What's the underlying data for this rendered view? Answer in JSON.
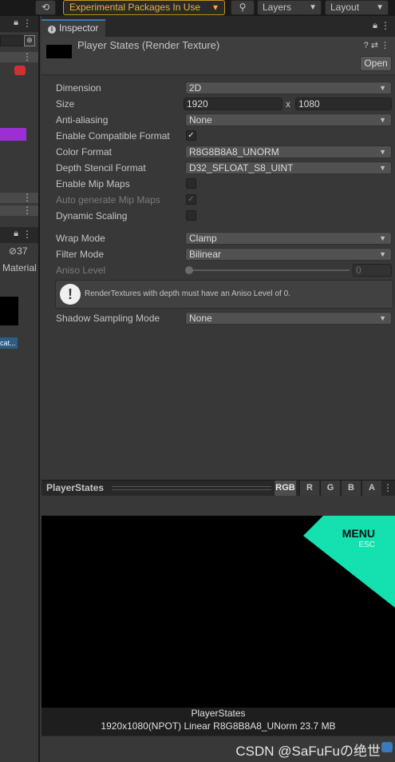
{
  "toolbar": {
    "experimental_label": "Experimental Packages In Use",
    "layers_label": "Layers",
    "layout_label": "Layout"
  },
  "left_panel": {
    "count_badge": "37",
    "material_label": "Material",
    "truncated_item": "cat..."
  },
  "inspector": {
    "tab_label": "Inspector",
    "asset_title": "Player States (Render Texture)",
    "open_label": "Open",
    "properties": {
      "dimension": {
        "label": "Dimension",
        "value": "2D"
      },
      "size": {
        "label": "Size",
        "width": "1920",
        "x": "x",
        "height": "1080"
      },
      "anti_aliasing": {
        "label": "Anti-aliasing",
        "value": "None"
      },
      "enable_compatible_format": {
        "label": "Enable Compatible Format",
        "checked": true
      },
      "color_format": {
        "label": "Color Format",
        "value": "R8G8B8A8_UNORM"
      },
      "depth_stencil_format": {
        "label": "Depth Stencil Format",
        "value": "D32_SFLOAT_S8_UINT"
      },
      "enable_mip_maps": {
        "label": "Enable Mip Maps",
        "checked": false
      },
      "auto_generate_mip_maps": {
        "label": "Auto generate Mip Maps",
        "checked": true
      },
      "dynamic_scaling": {
        "label": "Dynamic Scaling",
        "checked": false
      },
      "wrap_mode": {
        "label": "Wrap Mode",
        "value": "Clamp"
      },
      "filter_mode": {
        "label": "Filter Mode",
        "value": "Bilinear"
      },
      "aniso_level": {
        "label": "Aniso Level",
        "value": "0"
      },
      "shadow_sampling_mode": {
        "label": "Shadow Sampling Mode",
        "value": "None"
      }
    },
    "help_text": "RenderTextures with depth must have an Aniso Level of 0."
  },
  "preview": {
    "title": "PlayerStates",
    "channels": [
      "RGB",
      "R",
      "G",
      "B",
      "A"
    ],
    "active_channel": "RGB",
    "menu_text": "MENU",
    "esc_text": "ESC",
    "caption_name": "PlayerStates",
    "caption_info": "1920x1080(NPOT) Linear  R8G8B8A8_UNorm  23.7 MB",
    "accent_color": "#14e0b0"
  },
  "watermark": "CSDN @SaFuFuの绝世"
}
